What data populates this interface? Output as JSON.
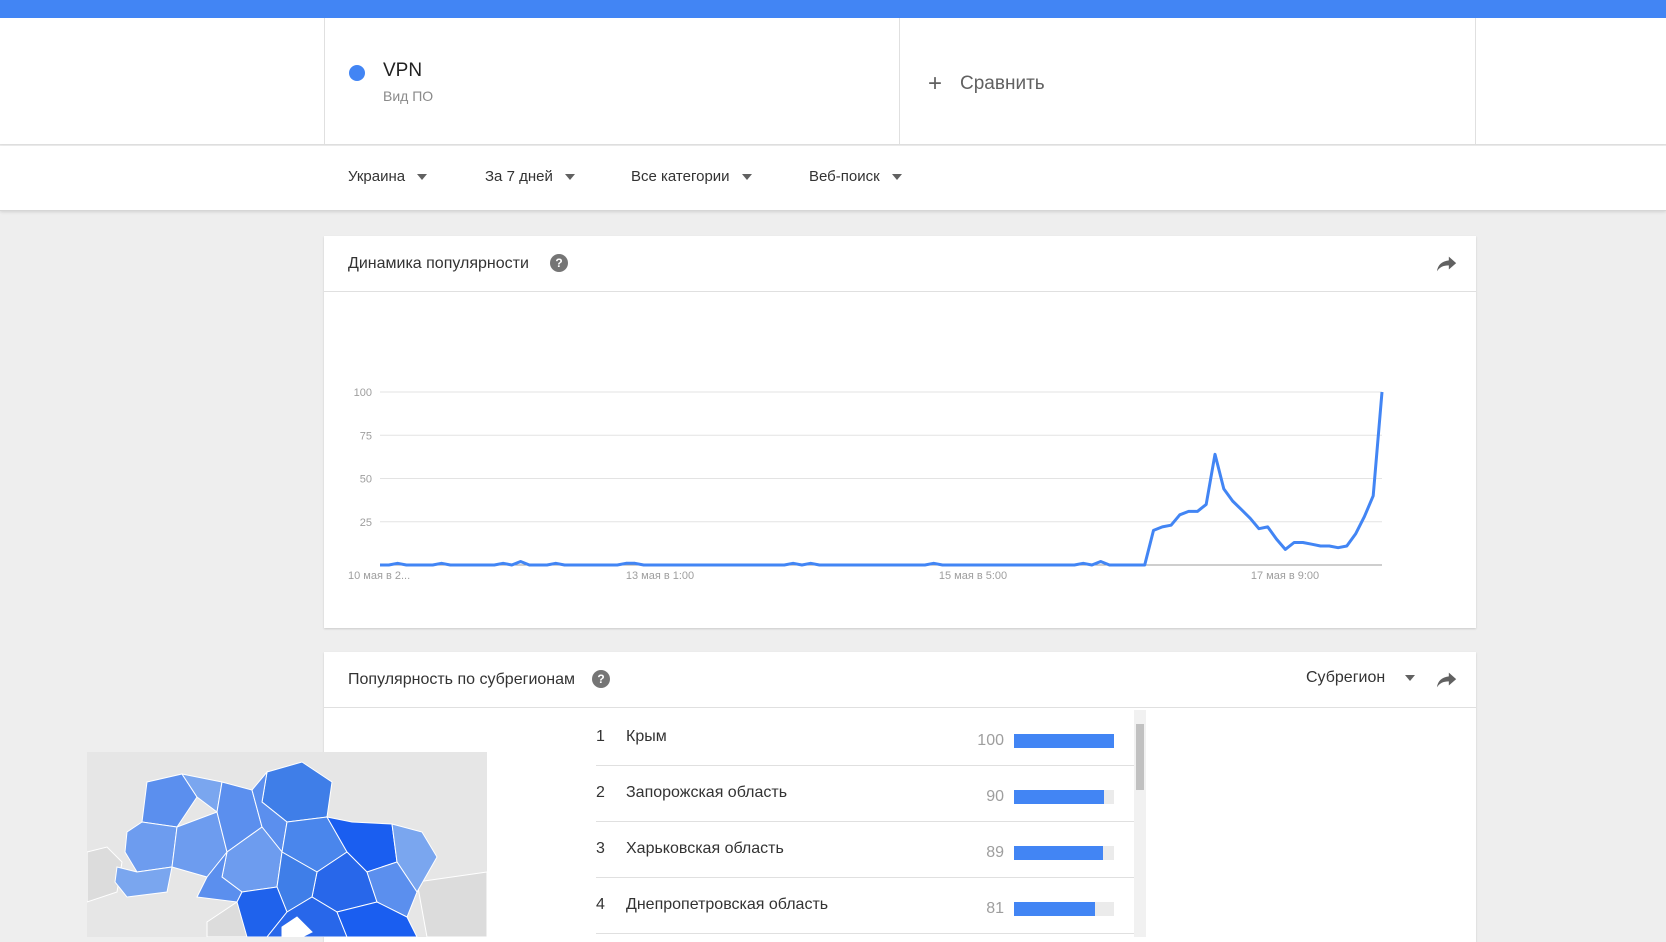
{
  "header": {
    "term": {
      "name": "VPN",
      "type": "Вид ПО",
      "color": "#4285f4"
    },
    "compare_label": "Сравнить"
  },
  "filters": {
    "region": "Украина",
    "period": "За 7 дней",
    "category": "Все категории",
    "search_type": "Веб-поиск"
  },
  "interest_over_time": {
    "title": "Динамика популярности",
    "help_icon": "?",
    "share_icon": "share-icon"
  },
  "chart_data": {
    "type": "line",
    "title": "",
    "xlabel": "",
    "ylabel": "",
    "ylim": [
      0,
      100
    ],
    "yticks": [
      100,
      75,
      50,
      25
    ],
    "xtick_labels": [
      "10 мая в 2...",
      "13 мая в 1:00",
      "15 мая в 5:00",
      "17 мая в 9:00"
    ],
    "grid": true,
    "series": [
      {
        "color": "#4285f4",
        "values": [
          0,
          0,
          1,
          0,
          0,
          0,
          0,
          1,
          0,
          0,
          0,
          0,
          0,
          0,
          1,
          0,
          2,
          0,
          0,
          0,
          1,
          0,
          0,
          0,
          0,
          0,
          0,
          0,
          1,
          1,
          0,
          0,
          0,
          0,
          0,
          0,
          0,
          0,
          0,
          0,
          0,
          0,
          0,
          0,
          0,
          0,
          0,
          1,
          0,
          1,
          0,
          0,
          0,
          0,
          0,
          0,
          0,
          0,
          0,
          0,
          0,
          0,
          0,
          1,
          0,
          0,
          0,
          0,
          0,
          0,
          0,
          0,
          0,
          0,
          0,
          0,
          0,
          0,
          0,
          0,
          1,
          0,
          2,
          0,
          0,
          0,
          0,
          0,
          20,
          22,
          23,
          29,
          31,
          31,
          35,
          64,
          44,
          37,
          32,
          27,
          21,
          22,
          15,
          9,
          13,
          13,
          12,
          11,
          11,
          10,
          11,
          18,
          28,
          40,
          100
        ]
      }
    ]
  },
  "interest_by_region": {
    "title": "Популярность по субрегионам",
    "help_icon": "?",
    "resolution": "Субрегион",
    "rows": [
      {
        "rank": "1",
        "name": "Крым",
        "value": "100",
        "fraction": 1.0
      },
      {
        "rank": "2",
        "name": "Запорожская область",
        "value": "90",
        "fraction": 0.9
      },
      {
        "rank": "3",
        "name": "Харьковская область",
        "value": "89",
        "fraction": 0.89
      },
      {
        "rank": "4",
        "name": "Днепропетровская область",
        "value": "81",
        "fraction": 0.81
      }
    ]
  },
  "colors": {
    "accent": "#4285f4",
    "map_dark": "#1a5ef0",
    "map_mid": "#3f7ee8",
    "map_light": "#7aa6ef"
  }
}
